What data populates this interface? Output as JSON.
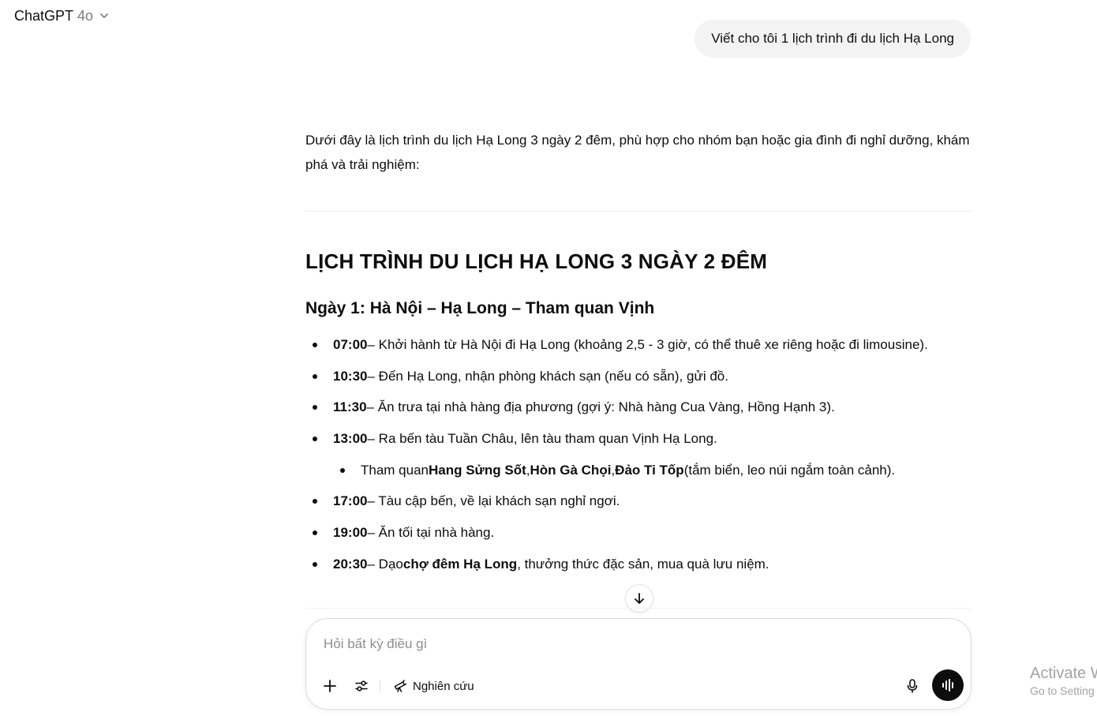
{
  "header": {
    "model_name": "ChatGPT",
    "model_version": "4o",
    "chevron_icon": "chevron-down-icon"
  },
  "conversation": {
    "user_message": "Viết cho tôi 1 lịch trình đi du lịch Hạ Long",
    "assistant": {
      "intro": "Dưới đây là lịch trình du lịch Hạ Long 3 ngày 2 đêm, phù hợp cho nhóm bạn hoặc gia đình đi nghỉ dưỡng, khám phá và trải nghiệm:",
      "title": "LỊCH TRÌNH DU LỊCH HẠ LONG 3 NGÀY 2 ĐÊM",
      "day1_heading": "Ngày 1: Hà Nội – Hạ Long – Tham quan Vịnh",
      "items": [
        {
          "time": "07:00",
          "text": " – Khởi hành từ Hà Nội đi Hạ Long (khoảng 2,5 - 3 giờ, có thể thuê xe riêng hoặc đi limousine)."
        },
        {
          "time": "10:30",
          "text": " – Đến Hạ Long, nhận phòng khách sạn (nếu có sẵn), gửi đồ."
        },
        {
          "time": "11:30",
          "text": " – Ăn trưa tại nhà hàng địa phương (gợi ý: Nhà hàng Cua Vàng, Hồng Hạnh 3)."
        },
        {
          "time": "13:00",
          "text": " – Ra bến tàu Tuần Châu, lên tàu tham quan Vịnh Hạ Long."
        },
        {
          "sub": {
            "prefix": "Tham quan ",
            "place1": "Hang Sửng Sốt",
            "sep1": ", ",
            "place2": "Hòn Gà Chọi",
            "sep2": ", ",
            "place3": "Đảo Ti Tốp",
            "suffix": " (tắm biển, leo núi ngắm toàn cảnh)."
          }
        },
        {
          "time": "17:00",
          "text": " – Tàu cập bến, về lại khách sạn nghỉ ngơi."
        },
        {
          "time": "19:00",
          "text": " – Ăn tối tại nhà hàng."
        },
        {
          "time": "20:30",
          "text_before": " – Dạo ",
          "bold": "chợ đêm Hạ Long",
          "text_after": ", thưởng thức đặc sản, mua quà lưu niệm."
        }
      ]
    }
  },
  "scroll_button_icon": "arrow-down-icon",
  "composer": {
    "placeholder": "Hỏi bất kỳ điều gì",
    "value": "",
    "tools": {
      "plus_icon": "plus-icon",
      "tune_icon": "sliders-icon",
      "research_icon": "telescope-icon",
      "research_label": "Nghiên cứu",
      "mic_icon": "microphone-icon",
      "voice_icon": "voice-mode-icon"
    }
  },
  "watermark": {
    "title": "Activate W",
    "subtitle": "Go to Setting"
  }
}
